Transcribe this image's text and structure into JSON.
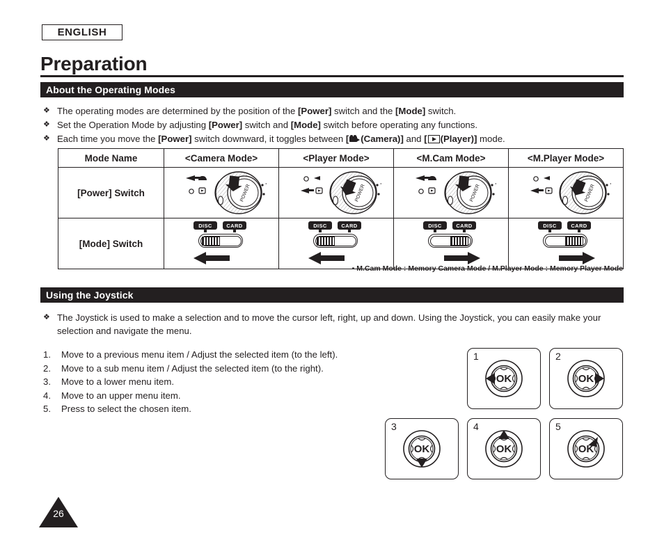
{
  "language_badge": "ENGLISH",
  "page_title": "Preparation",
  "page_number": "26",
  "sections": {
    "modes": {
      "bar_title": "About the Operating Modes",
      "bullets": [
        {
          "parts": [
            {
              "t": "The operating modes are determined by the position of the ",
              "b": false
            },
            {
              "t": "[Power]",
              "b": true
            },
            {
              "t": " switch and the ",
              "b": false
            },
            {
              "t": "[Mode]",
              "b": true
            },
            {
              "t": " switch.",
              "b": false
            }
          ]
        },
        {
          "parts": [
            {
              "t": "Set the Operation Mode by adjusting ",
              "b": false
            },
            {
              "t": "[Power]",
              "b": true
            },
            {
              "t": " switch and ",
              "b": false
            },
            {
              "t": "[Mode]",
              "b": true
            },
            {
              "t": " switch before operating any functions.",
              "b": false
            }
          ]
        },
        {
          "parts": [
            {
              "t": "Each time you move the ",
              "b": false
            },
            {
              "t": "[Power]",
              "b": true
            },
            {
              "t": " switch downward, it toggles between ",
              "b": false
            },
            {
              "t": "[",
              "b": true
            },
            {
              "icon": "camcorder-icon"
            },
            {
              "t": "(Camera)]",
              "b": true
            },
            {
              "t": " and ",
              "b": false
            },
            {
              "t": "[",
              "b": true
            },
            {
              "icon": "play-icon"
            },
            {
              "t": "(Player)]",
              "b": true
            },
            {
              "t": " mode.",
              "b": false
            }
          ]
        }
      ],
      "table": {
        "headers": [
          "Mode Name",
          "<Camera Mode>",
          "<Player Mode>",
          "<M.Cam Mode>",
          "<M.Player Mode>"
        ],
        "rows": [
          {
            "label": "[Power] Switch",
            "cells": [
              {
                "icon": "power-dial-camera"
              },
              {
                "icon": "power-dial-player"
              },
              {
                "icon": "power-dial-camera"
              },
              {
                "icon": "power-dial-player"
              }
            ]
          },
          {
            "label": "[Mode] Switch",
            "cells": [
              {
                "icon": "mode-switch-disc",
                "tag_left": "DISC",
                "tag_right": "CARD",
                "knob": "left",
                "arrow": "left"
              },
              {
                "icon": "mode-switch-disc",
                "tag_left": "DISC",
                "tag_right": "CARD",
                "knob": "left",
                "arrow": "left"
              },
              {
                "icon": "mode-switch-card",
                "tag_left": "DISC",
                "tag_right": "CARD",
                "knob": "right",
                "arrow": "right"
              },
              {
                "icon": "mode-switch-card",
                "tag_left": "DISC",
                "tag_right": "CARD",
                "knob": "right",
                "arrow": "right"
              }
            ]
          }
        ]
      },
      "table_note": "▪ M.Cam Mode : Memory Camera Mode / M.Player Mode : Memory Player Mode"
    },
    "joystick": {
      "bar_title": "Using the Joystick",
      "bullets": [
        {
          "parts": [
            {
              "t": "The Joystick is used to make a selection and to move the cursor left, right, up and down. Using the Joystick, you can easily make your selection and navigate the menu.",
              "b": false
            }
          ]
        }
      ],
      "steps": [
        {
          "num": "1.",
          "text": "Move to a previous menu item / Adjust the selected item (to the left)."
        },
        {
          "num": "2.",
          "text": "Move to a sub menu item / Adjust the selected item (to the right)."
        },
        {
          "num": "3.",
          "text": "Move to a lower menu item."
        },
        {
          "num": "4.",
          "text": "Move to an upper menu item."
        },
        {
          "num": "5.",
          "text": "Press to select the chosen item."
        }
      ],
      "diagrams": [
        {
          "index": "1",
          "center_label": "OK",
          "direction": "left"
        },
        {
          "index": "2",
          "center_label": "OK",
          "direction": "right"
        },
        {
          "index": "3",
          "center_label": "OK",
          "direction": "down"
        },
        {
          "index": "4",
          "center_label": "OK",
          "direction": "up"
        },
        {
          "index": "5",
          "center_label": "OK",
          "direction": "press"
        }
      ]
    }
  },
  "colors": {
    "ink": "#231f20",
    "paper": "#ffffff"
  }
}
